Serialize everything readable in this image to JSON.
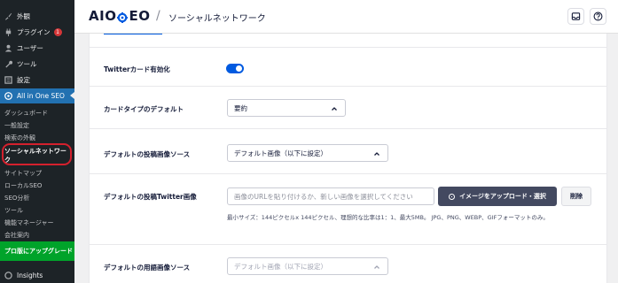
{
  "sidebar": {
    "top_items": [
      {
        "label": "外観",
        "icon": "brush-icon"
      },
      {
        "label": "プラグイン",
        "icon": "plugin-icon",
        "badge": "1"
      },
      {
        "label": "ユーザー",
        "icon": "user-icon"
      },
      {
        "label": "ツール",
        "icon": "wrench-icon"
      },
      {
        "label": "設定",
        "icon": "settings-icon"
      }
    ],
    "active_item": {
      "label": "All in One SEO",
      "icon": "aioseo-icon"
    },
    "sub_items": [
      {
        "label": "ダッシュボード"
      },
      {
        "label": "一般設定"
      },
      {
        "label": "検索の外観"
      },
      {
        "label_line1": "ソーシャルネットワー",
        "label_line2": "ク",
        "current": true
      },
      {
        "label": "サイトマップ"
      },
      {
        "label": "ローカルSEO"
      },
      {
        "label": "SEO分析"
      },
      {
        "label": "ツール"
      },
      {
        "label": "機能マネージャー"
      },
      {
        "label": "会社案内"
      }
    ],
    "upgrade_label": "プロ版にアップグレード",
    "bottom_item": {
      "label": "Insights",
      "icon": "insights-icon"
    }
  },
  "header": {
    "logo_text_left": "AIO",
    "logo_text_right": "EO",
    "separator": "/",
    "page_title": "ソーシャルネットワーク"
  },
  "form": {
    "twitter_card": {
      "label": "Twitterカード有効化",
      "enabled": true
    },
    "card_type": {
      "label": "カードタイプのデフォルト",
      "value": "要約"
    },
    "default_image_source": {
      "label": "デフォルトの投稿画像ソース",
      "value": "デフォルト画像（以下に設定）"
    },
    "twitter_image": {
      "label": "デフォルトの投稿Twitter画像",
      "placeholder": "画像のURLを貼り付けるか、新しい画像を選択してください",
      "upload_label": "イメージをアップロード・選択",
      "remove_label": "削除",
      "help": "最小サイズ：144ピクセルx 144ピクセル、理想的な比率は1：1、最大5MB。 JPG、PNG、WEBP、GIFフォーマットのみ。"
    },
    "term_image_source": {
      "label": "デフォルトの用語画像ソース",
      "value": "デフォルト画像（以下に設定）"
    }
  },
  "colors": {
    "accent": "#005ae0",
    "sidebar_bg": "#1d2327",
    "active_bg": "#2271b1",
    "upgrade_bg": "#00a32a",
    "highlight_ring": "#d4202d"
  }
}
